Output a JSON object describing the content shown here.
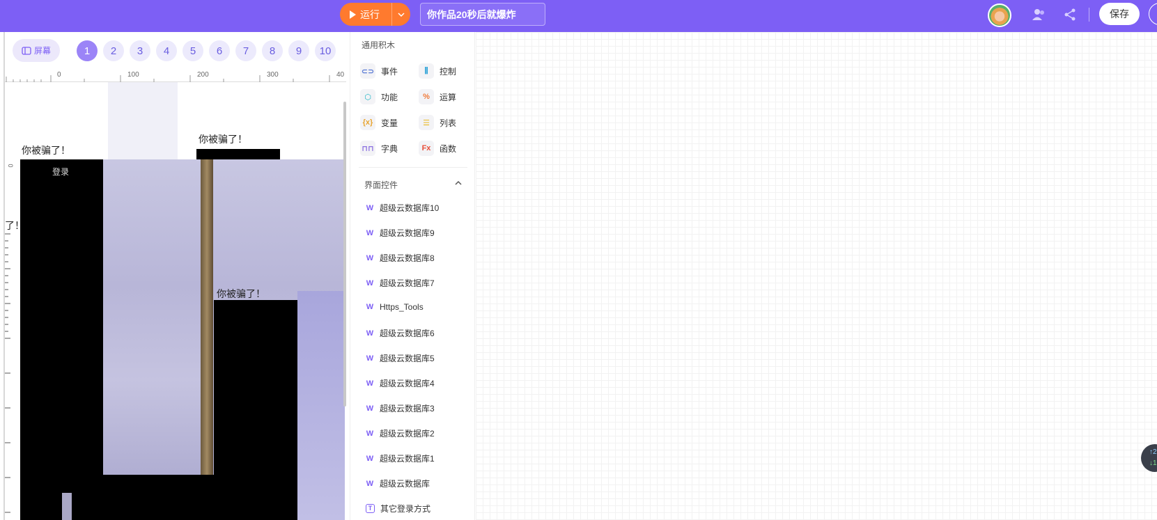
{
  "topbar": {
    "run_label": "运行",
    "title_value": "你作品20秒后就爆炸",
    "save_label": "保存",
    "accent_color": "#7d5ff5",
    "run_color": "#ff7a2e"
  },
  "stage": {
    "screen_label": "屏幕",
    "pages": [
      "1",
      "2",
      "3",
      "4",
      "5",
      "6",
      "7",
      "8",
      "9",
      "10"
    ],
    "active_page": "1",
    "ruler_ticks": [
      "0",
      "100",
      "200",
      "300",
      "40"
    ],
    "ruler_vertical_tick": "0",
    "texts": {
      "fooled_1": "你被骗了！",
      "fooled_2": "你被骗了！",
      "fooled_3": "你被骗了！",
      "fooled_partial": "了！",
      "login": "登录"
    }
  },
  "blocks": {
    "header": "通用积木",
    "categories": [
      {
        "label": "事件",
        "icon": "event-icon",
        "glyph": "⊂⊃",
        "color": "#5b7bd5"
      },
      {
        "label": "控制",
        "icon": "control-icon",
        "glyph": "⫼",
        "color": "#2aa1d6"
      },
      {
        "label": "功能",
        "icon": "function-icon",
        "glyph": "⬡",
        "color": "#1fb5c4"
      },
      {
        "label": "运算",
        "icon": "operator-icon",
        "glyph": "%",
        "color": "#f07a3a"
      },
      {
        "label": "变量",
        "icon": "variable-icon",
        "glyph": "{x}",
        "color": "#e8a530"
      },
      {
        "label": "列表",
        "icon": "list-icon",
        "glyph": "☰",
        "color": "#e8b820"
      },
      {
        "label": "字典",
        "icon": "dictionary-icon",
        "glyph": "⊓⊓",
        "color": "#8b6fe0"
      },
      {
        "label": "函数",
        "icon": "fx-icon",
        "glyph": "Fx",
        "color": "#e84e3a"
      }
    ],
    "ui_controls_label": "界面控件",
    "widgets": [
      {
        "label": "超级云数据库10",
        "icon": "w-icon",
        "glyph": "W"
      },
      {
        "label": "超级云数据库9",
        "icon": "w-icon",
        "glyph": "W"
      },
      {
        "label": "超级云数据库8",
        "icon": "w-icon",
        "glyph": "W"
      },
      {
        "label": "超级云数据库7",
        "icon": "w-icon",
        "glyph": "W"
      },
      {
        "label": "Https_Tools",
        "icon": "w-icon",
        "glyph": "W"
      },
      {
        "label": "超级云数据库6",
        "icon": "w-icon",
        "glyph": "W"
      },
      {
        "label": "超级云数据库5",
        "icon": "w-icon",
        "glyph": "W"
      },
      {
        "label": "超级云数据库4",
        "icon": "w-icon",
        "glyph": "W"
      },
      {
        "label": "超级云数据库3",
        "icon": "w-icon",
        "glyph": "W"
      },
      {
        "label": "超级云数据库2",
        "icon": "w-icon",
        "glyph": "W"
      },
      {
        "label": "超级云数据库1",
        "icon": "w-icon",
        "glyph": "W"
      },
      {
        "label": "超级云数据库",
        "icon": "w-icon",
        "glyph": "W"
      },
      {
        "label": "其它登录方式",
        "icon": "text-box-icon",
        "glyph": "T"
      }
    ]
  },
  "counter": {
    "up": "↑2",
    "down": "↓1"
  }
}
